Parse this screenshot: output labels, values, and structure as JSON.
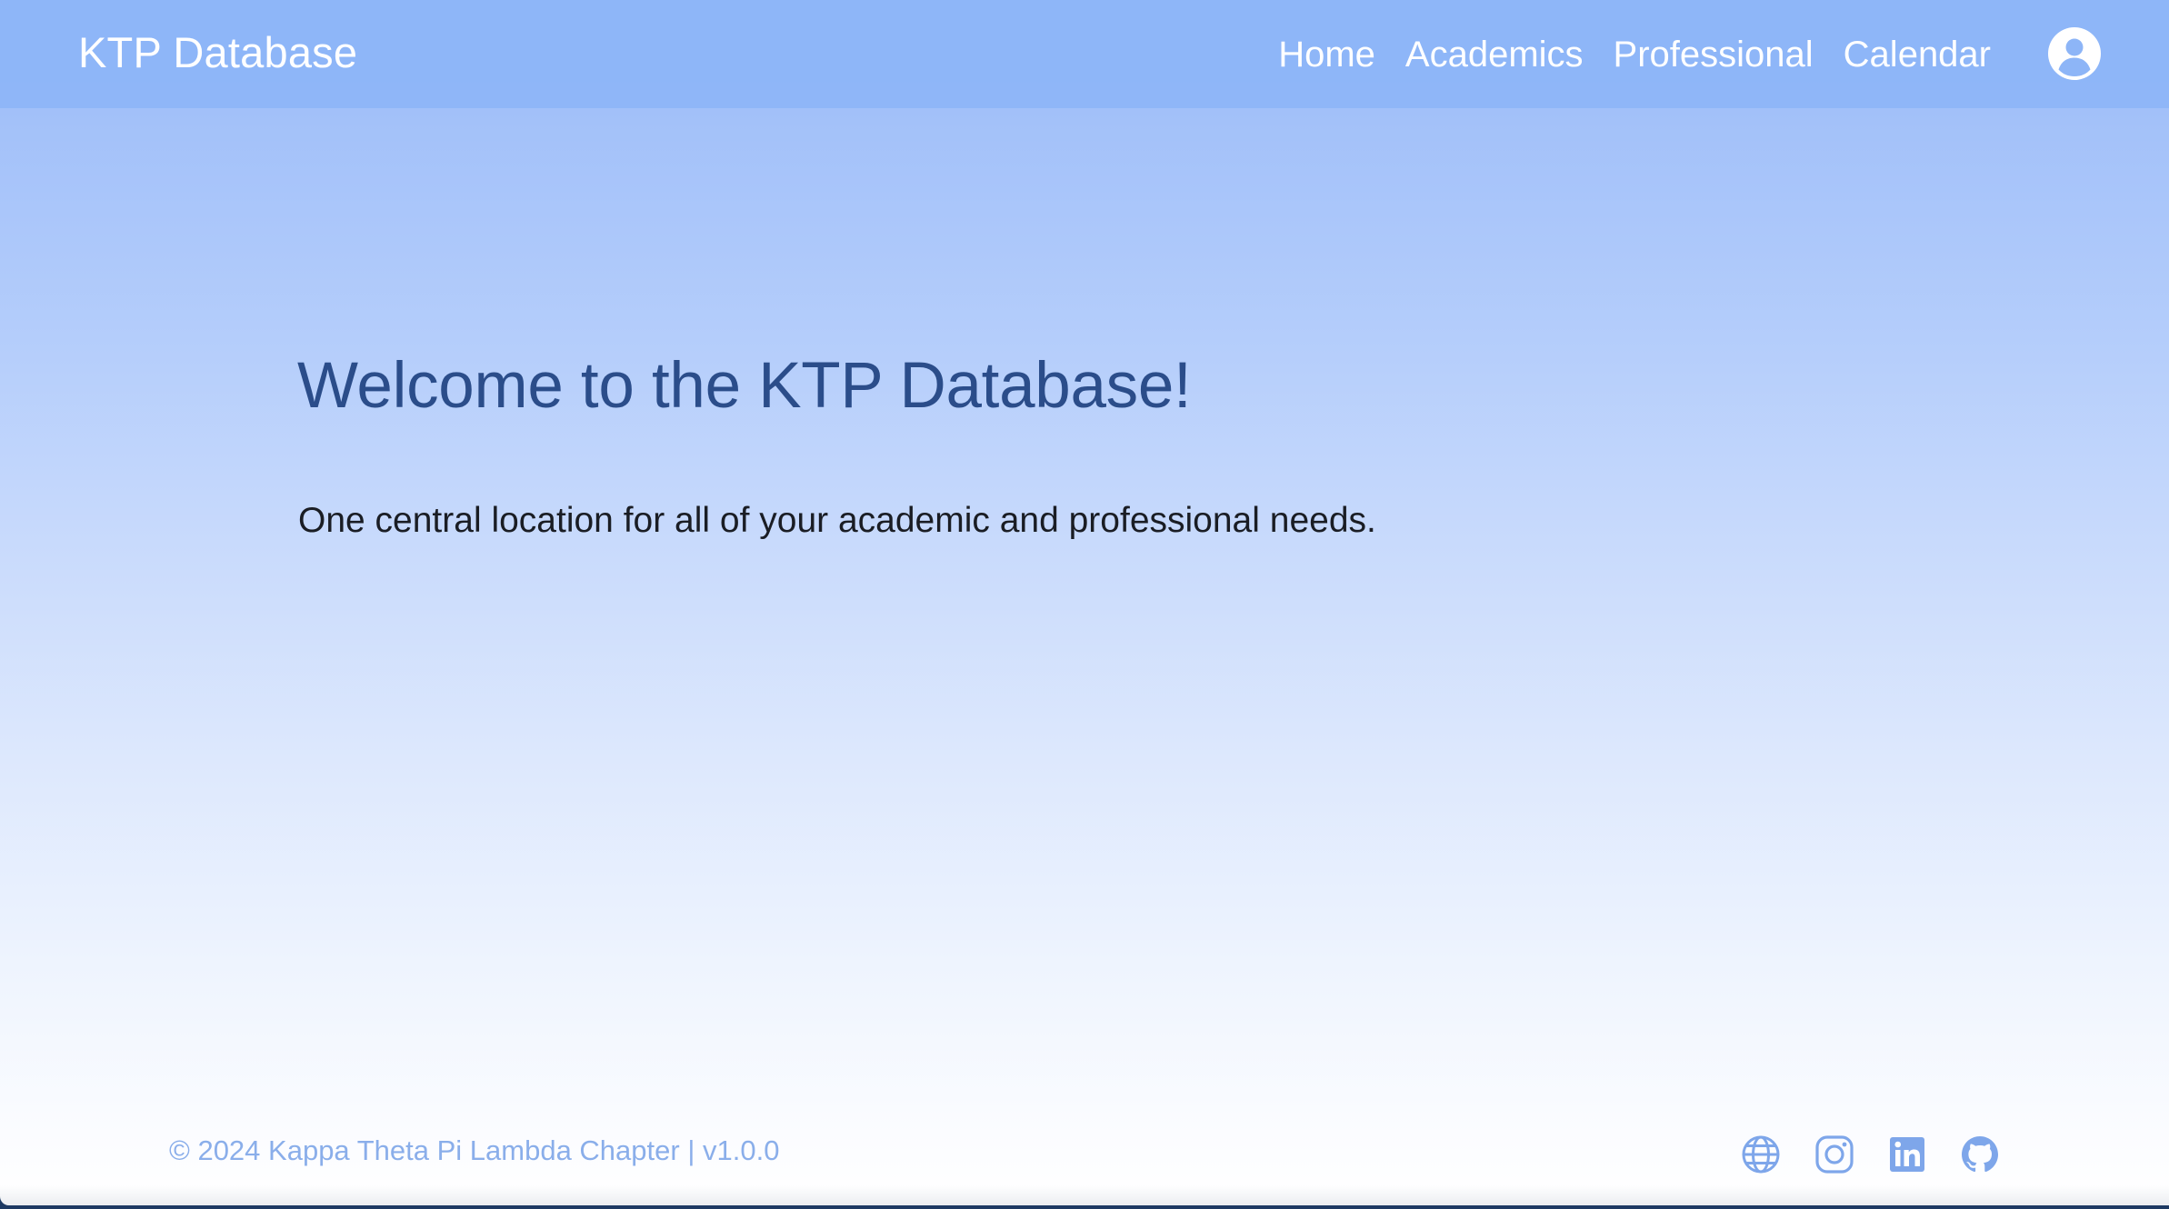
{
  "navbar": {
    "brand": "KTP Database",
    "links": [
      {
        "label": "Home"
      },
      {
        "label": "Academics"
      },
      {
        "label": "Professional"
      },
      {
        "label": "Calendar"
      }
    ],
    "user_icon": "user-circle-icon"
  },
  "hero": {
    "title": "Welcome to the KTP Database!",
    "subtitle": "One central location for all of your academic and professional needs."
  },
  "footer": {
    "copyright": "© 2024 Kappa Theta Pi Lambda Chapter | v1.0.0",
    "social_icons": [
      "globe-icon",
      "instagram-icon",
      "linkedin-icon",
      "github-icon"
    ]
  },
  "colors": {
    "navbar": "#8db5f7",
    "title": "#2b4d8a",
    "footer_text": "#8aaeea",
    "icon": "#7ea6ea"
  }
}
